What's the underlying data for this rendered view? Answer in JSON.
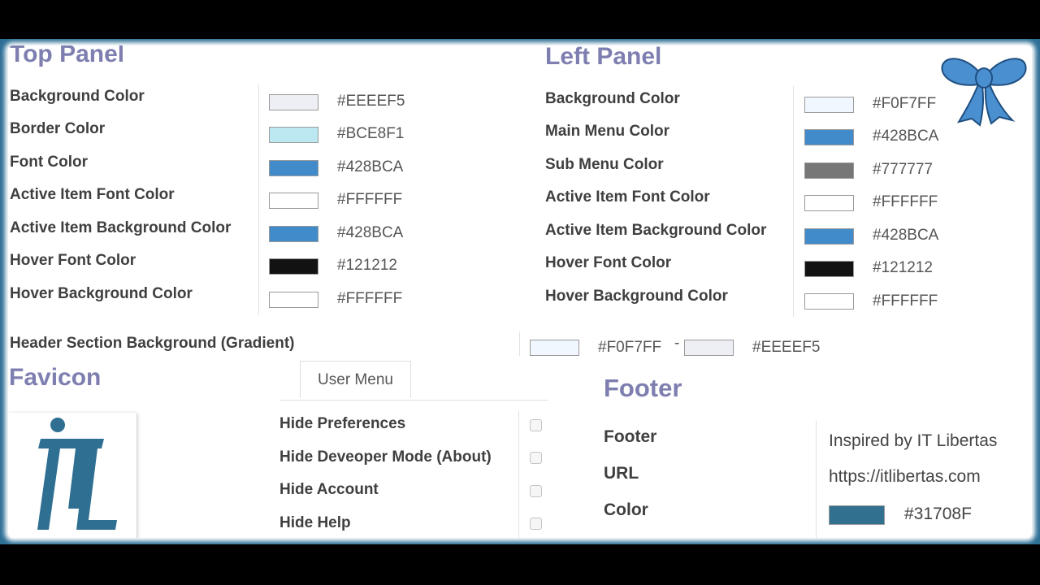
{
  "top_panel": {
    "title": "Top Panel",
    "rows": [
      {
        "label": "Background Color",
        "hex": "#EEEEF5",
        "color": "#EEEEF5"
      },
      {
        "label": "Border Color",
        "hex": "#BCE8F1",
        "color": "#BCE8F1"
      },
      {
        "label": "Font Color",
        "hex": "#428BCA",
        "color": "#428BCA"
      },
      {
        "label": "Active Item Font Color",
        "hex": "#FFFFFF",
        "color": "#FFFFFF"
      },
      {
        "label": "Active Item Background Color",
        "hex": "#428BCA",
        "color": "#428BCA"
      },
      {
        "label": "Hover Font Color",
        "hex": "#121212",
        "color": "#121212"
      },
      {
        "label": "Hover Background Color",
        "hex": "#FFFFFF",
        "color": "#FFFFFF"
      }
    ]
  },
  "left_panel": {
    "title": "Left Panel",
    "rows": [
      {
        "label": "Background Color",
        "hex": "#F0F7FF",
        "color": "#F0F7FF"
      },
      {
        "label": "Main Menu Color",
        "hex": "#428BCA",
        "color": "#428BCA"
      },
      {
        "label": "Sub Menu Color",
        "hex": "#777777",
        "color": "#777777"
      },
      {
        "label": "Active Item Font Color",
        "hex": "#FFFFFF",
        "color": "#FFFFFF"
      },
      {
        "label": "Active Item Background Color",
        "hex": "#428BCA",
        "color": "#428BCA"
      },
      {
        "label": "Hover Font Color",
        "hex": "#121212",
        "color": "#121212"
      },
      {
        "label": "Hover Background Color",
        "hex": "#FFFFFF",
        "color": "#FFFFFF"
      }
    ]
  },
  "header_gradient": {
    "label": "Header Section Background (Gradient)",
    "start_hex": "#F0F7FF",
    "start_color": "#F0F7FF",
    "separator": "-",
    "end_hex": "#EEEEF5",
    "end_color": "#EEEEF5"
  },
  "favicon": {
    "title": "Favicon",
    "logo_color": "#2f6f92"
  },
  "user_menu": {
    "tab_label": "User Menu",
    "items": [
      {
        "label": "Hide Preferences",
        "checked": false
      },
      {
        "label": "Hide Deveoper Mode (About)",
        "checked": false
      },
      {
        "label": "Hide Account",
        "checked": false
      },
      {
        "label": "Hide Help",
        "checked": false
      }
    ]
  },
  "footer": {
    "title": "Footer",
    "labels": [
      "Footer",
      "URL",
      "Color"
    ],
    "text": "Inspired by IT Libertas",
    "url": "https://itlibertas.com",
    "color_hex": "#31708F",
    "color": "#31708F"
  },
  "decoration": {
    "bow_color": "#4a8fcf",
    "icon": "bow-icon"
  }
}
